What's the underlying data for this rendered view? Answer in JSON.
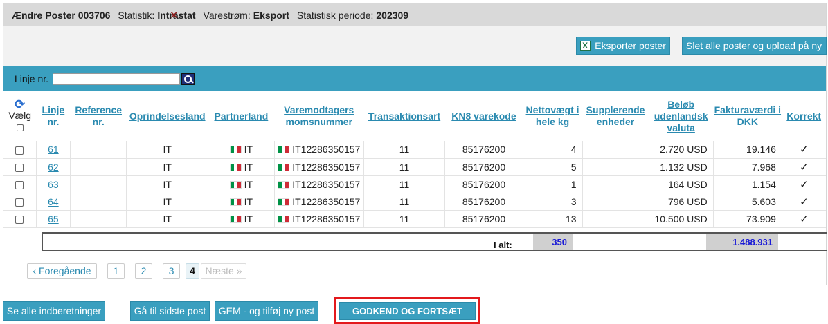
{
  "header": {
    "title": "Ændre Poster 003706",
    "statistik_label": "Statistik:",
    "statistik_value": "Intrastat",
    "varestrom_label": "Varestrøm:",
    "varestrom_value": "Eksport",
    "periode_label": "Statistisk periode:",
    "periode_value": "202309"
  },
  "actions": {
    "export_label": "Eksporter poster",
    "delete_label": "Slet alle poster og upload på ny"
  },
  "filter": {
    "label": "Linje nr.",
    "value": "",
    "clear_symbol": "✕"
  },
  "table": {
    "select_label": "Vælg",
    "columns": [
      "Linje nr.",
      "Reference nr.",
      "Oprindelsesland",
      "Partnerland",
      "Varemodtagers momsnummer",
      "Transaktionsart",
      "KN8 varekode",
      "Nettovægt i hele kg",
      "Supplerende enheder",
      "Beløb udenlandsk valuta",
      "Fakturaværdi i DKK",
      "Korrekt"
    ],
    "rows": [
      {
        "line": "61",
        "ref": "",
        "origin": "IT",
        "partner": "IT",
        "vat": "IT12286350157",
        "trans": "11",
        "kn8": "85176200",
        "weight": "4",
        "supp": "",
        "foreign": "2.720 USD",
        "dkk": "19.146",
        "ok": "✓"
      },
      {
        "line": "62",
        "ref": "",
        "origin": "IT",
        "partner": "IT",
        "vat": "IT12286350157",
        "trans": "11",
        "kn8": "85176200",
        "weight": "5",
        "supp": "",
        "foreign": "1.132 USD",
        "dkk": "7.968",
        "ok": "✓"
      },
      {
        "line": "63",
        "ref": "",
        "origin": "IT",
        "partner": "IT",
        "vat": "IT12286350157",
        "trans": "11",
        "kn8": "85176200",
        "weight": "1",
        "supp": "",
        "foreign": "164 USD",
        "dkk": "1.154",
        "ok": "✓"
      },
      {
        "line": "64",
        "ref": "",
        "origin": "IT",
        "partner": "IT",
        "vat": "IT12286350157",
        "trans": "11",
        "kn8": "85176200",
        "weight": "3",
        "supp": "",
        "foreign": "796 USD",
        "dkk": "5.603",
        "ok": "✓"
      },
      {
        "line": "65",
        "ref": "",
        "origin": "IT",
        "partner": "IT",
        "vat": "IT12286350157",
        "trans": "11",
        "kn8": "85176200",
        "weight": "13",
        "supp": "",
        "foreign": "10.500 USD",
        "dkk": "73.909",
        "ok": "✓"
      }
    ],
    "total_label": "I alt:",
    "total_weight": "350",
    "total_dkk": "1.488.931"
  },
  "pager": {
    "prev": "‹ Foregående",
    "pages": [
      "1",
      "2",
      "3",
      "4"
    ],
    "current": "4",
    "next": "Næste »"
  },
  "bottom": {
    "all_reports": "Se alle indberetninger",
    "last_post": "Gå til sidste post",
    "save_add": "GEM - og tilføj ny post",
    "approve": "GODKEND OG FORTSÆT"
  },
  "colors": {
    "accent": "#3a9fbf",
    "link": "#2a8ab0",
    "header_bg": "#d9d9d9",
    "highlight_frame": "#e3191c",
    "total_text": "#1a1ad6"
  }
}
